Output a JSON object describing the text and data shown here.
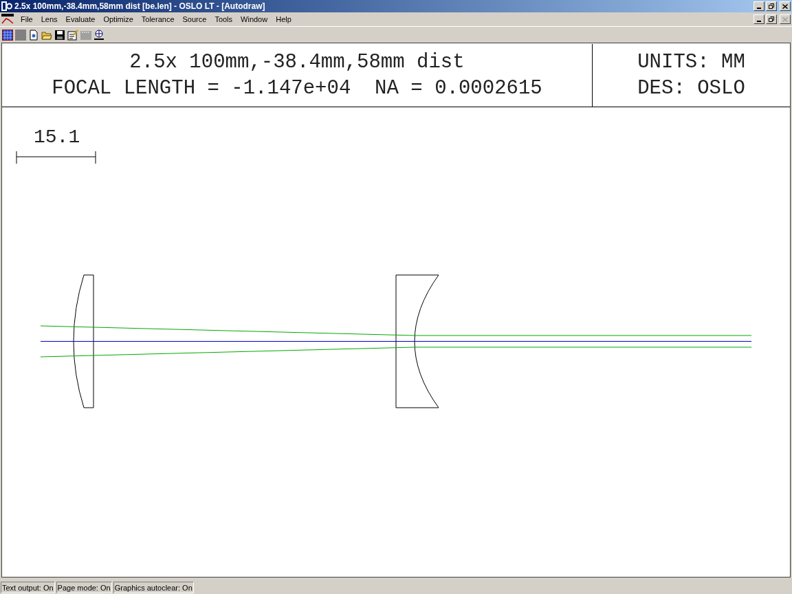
{
  "window": {
    "title": "2.5x 100mm,-38.4mm,58mm dist [be.len] - OSLO LT - [Autodraw]"
  },
  "menu": [
    {
      "label": "File"
    },
    {
      "label": "Lens"
    },
    {
      "label": "Evaluate"
    },
    {
      "label": "Optimize"
    },
    {
      "label": "Tolerance"
    },
    {
      "label": "Source"
    },
    {
      "label": "Tools"
    },
    {
      "label": "Window"
    },
    {
      "label": "Help"
    }
  ],
  "document_controls": {
    "close_disabled": true
  },
  "header": {
    "title": "2.5x 100mm,-38.4mm,58mm dist",
    "focal_line": "FOCAL LENGTH = -1.147e+04  NA = 0.0002615",
    "units": "UNITS: MM",
    "designer": "DES: OSLO"
  },
  "scale_bar": {
    "label": "15.1"
  },
  "status_bar": [
    "Text output: On",
    "Page mode: On",
    "Graphics autoclear: On"
  ]
}
